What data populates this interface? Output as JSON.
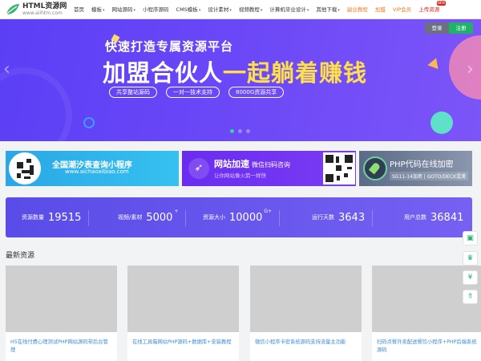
{
  "header": {
    "logo_title": "HTML资源网",
    "logo_url": "www.aiihtm.com",
    "nav": [
      {
        "label": "首页",
        "caret": false,
        "style": "normal"
      },
      {
        "label": "模板",
        "caret": true,
        "style": "normal"
      },
      {
        "label": "网站源码",
        "caret": true,
        "style": "normal"
      },
      {
        "label": "小程序源码",
        "caret": false,
        "style": "normal"
      },
      {
        "label": "CMS模板",
        "caret": true,
        "style": "normal"
      },
      {
        "label": "设计素材",
        "caret": true,
        "style": "normal"
      },
      {
        "label": "视频教程",
        "caret": true,
        "style": "normal"
      },
      {
        "label": "计算机毕业设计",
        "caret": true,
        "style": "normal"
      },
      {
        "label": "其他下载",
        "caret": true,
        "style": "normal"
      },
      {
        "label": "副业教程",
        "caret": false,
        "style": "orange"
      },
      {
        "label": "加盟",
        "caret": false,
        "style": "orange"
      },
      {
        "label": "VIP会员",
        "caret": false,
        "style": "orange"
      },
      {
        "label": "上传资源",
        "caret": false,
        "style": "red",
        "badge": "NEW"
      }
    ],
    "caret_glyph": "▾",
    "login_label": "登录",
    "register_label": "注册"
  },
  "hero": {
    "subtitle": "快速打造专属资源平台",
    "title_part1": "加盟合伙人",
    "title_part2": "一起躺着赚钱",
    "pills": [
      "共享整站源码",
      "一对一技术支持",
      "8000G资源共享"
    ],
    "slide_count": 3,
    "active_slide": 1,
    "prev_glyph": "‹",
    "next_glyph": "›"
  },
  "banners": {
    "b1_title": "全国潮汐表查询小程序",
    "b1_url": "www.aichaoxibiao.com",
    "b2_title": "网站加速",
    "b2_title_small": "微信扫码咨询",
    "b2_sub": "让你网站像火箭一样快",
    "b3_title": "PHP代码在线加密",
    "b3_sub": "SG11-14加密 | GOTO/DECK混淆"
  },
  "stats": [
    {
      "label": "资源数量",
      "value": "19515",
      "suffix": ""
    },
    {
      "label": "视频/素材",
      "value": "5000",
      "suffix": "+"
    },
    {
      "label": "资源大小",
      "value": "10000",
      "suffix": "G+"
    },
    {
      "label": "运行天数",
      "value": "3643",
      "suffix": ""
    },
    {
      "label": "用户总数",
      "value": "36841",
      "suffix": ""
    }
  ],
  "latest": {
    "title": "最新资源",
    "cards": [
      "H5在线付费心理测试PHP网站源码带后台管理",
      "在线工具箱网站PHP源码+数据库+安装教程",
      "微信小程序卡密系统源码支持流量主功能",
      "扫码点餐外卖配送餐饮小程序+PHP后端系统源码"
    ]
  },
  "side_tools": [
    {
      "icon": "picture-icon",
      "glyph": "▣"
    },
    {
      "icon": "crown-icon",
      "glyph": "♛"
    },
    {
      "icon": "yen-icon",
      "glyph": "¥"
    },
    {
      "icon": "back-to-top-icon",
      "glyph": "⇑"
    }
  ],
  "colors": {
    "accent_green": "#21b26a",
    "hero_purple": "#5b3ff5",
    "highlight_yellow": "#ffe04b",
    "link_blue": "#3a8dde",
    "stats_purple": "#6f5bf0"
  }
}
